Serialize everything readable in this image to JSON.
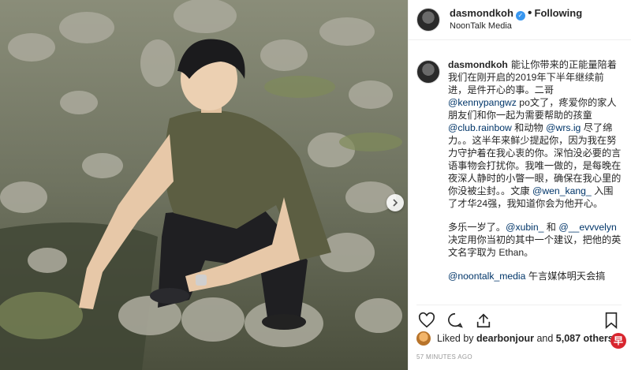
{
  "post": {
    "author": "dasmondkoh",
    "follow_state": "Following",
    "location": "NoonTalk Media",
    "caption_paragraphs": [
      [
        {
          "t": "能让你带来的正能量陪着我们在刚开启的2019年下半年继续前进，是件开心的事。二哥 "
        },
        {
          "m": "@kennypangwz"
        },
        {
          "t": " po文了，疼爱你的家人朋友们和你一起为需要帮助的孩童 "
        },
        {
          "m": "@club.rainbow"
        },
        {
          "t": " 和动物 "
        },
        {
          "m": "@wrs.ig"
        },
        {
          "t": " 尽了绵力。。这半年来鲜少提起你，因为我在努力守护着在我心衷的你。深怕没必要的言语事物会打扰你。我唯一做的，是每晚在夜深人静时的小瞥一眼，确保在我心里的你没被尘封。。文康 "
        },
        {
          "m": "@wen_kang_"
        },
        {
          "t": " 入围了才华24强，我知道你会为他开心。"
        }
      ],
      [
        {
          "t": "多乐一岁了。"
        },
        {
          "m": "@xubin_"
        },
        {
          "t": " 和 "
        },
        {
          "m": "@__evvvelyn"
        },
        {
          "t": " 决定用你当初的其中一个建议，把他的英文名字取为 Ethan。"
        }
      ],
      [
        {
          "m": "@noontalk_media"
        },
        {
          "t": " 午言媒体明天会搞"
        }
      ]
    ],
    "liked_by_prefix": "Liked by",
    "liked_by_user": "dearbonjour",
    "liked_by_and": "and",
    "likes_count": "5,087 others",
    "timestamp": "57 MINUTES AGO",
    "watermark": "早"
  },
  "icons": {
    "verified": "verified-badge-icon",
    "like": "heart-icon",
    "comment": "comment-bubble-icon",
    "share": "share-icon",
    "save": "bookmark-icon",
    "next": "chevron-right-icon"
  },
  "colors": {
    "verified_blue": "#3897f0",
    "mention": "#003569",
    "watermark_red": "#d8262f"
  }
}
